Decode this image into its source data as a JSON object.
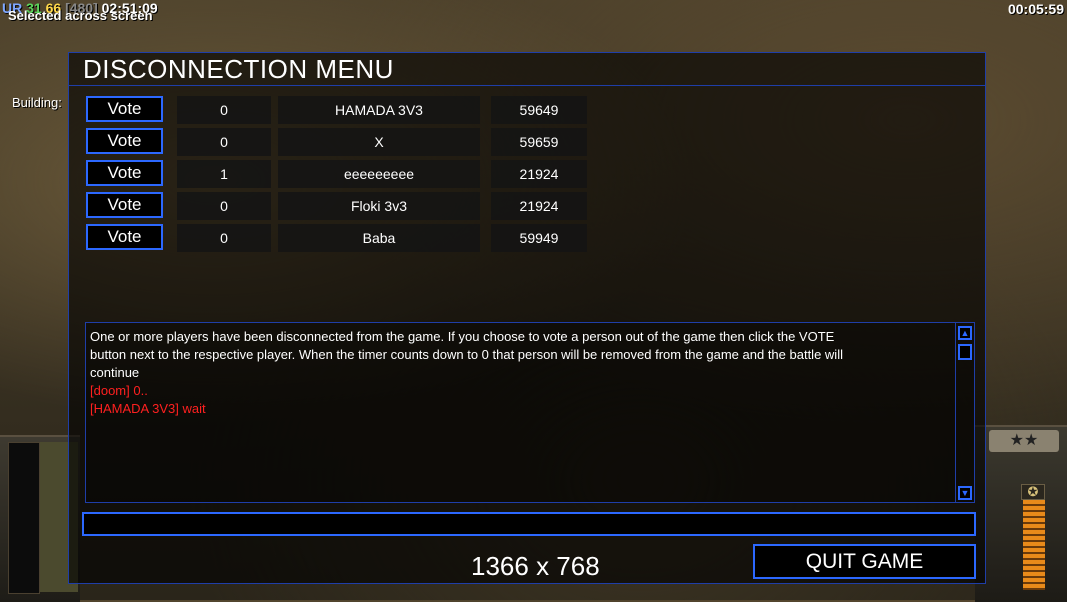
{
  "hud": {
    "ur_label": "UR",
    "stat_a": "31",
    "stat_b": "66",
    "stat_c": "[480]",
    "clock": "02:51:09",
    "selected_text": "Selected across screen",
    "game_timer": "00:05:59",
    "building_label": "Building:"
  },
  "menu": {
    "title": "DISCONNECTION MENU",
    "vote_label": "Vote",
    "players": [
      {
        "count": "0",
        "name": "HAMADA 3V3",
        "timer": "59649"
      },
      {
        "count": "0",
        "name": "X",
        "timer": "59659"
      },
      {
        "count": "1",
        "name": "eeeeeeeee",
        "timer": "21924"
      },
      {
        "count": "0",
        "name": "Floki 3v3",
        "timer": "21924"
      },
      {
        "count": "0",
        "name": "Baba",
        "timer": "59949"
      }
    ],
    "chat": {
      "info_line_1": "One or more players have been disconnected from the game. If you choose to vote a person out of the game then click the VOTE",
      "info_line_2": " button next to the respective player. When the timer counts down to 0 that person will be removed from the game and the battle will",
      "info_line_3": " continue",
      "messages": [
        "[doom] 0..",
        "[HAMADA 3V3] wait"
      ]
    },
    "chat_input_value": "",
    "resolution_text": "1366 x 768",
    "quit_label": "QUIT GAME"
  },
  "colors": {
    "accent_blue": "#2c68ff",
    "panel_border": "#1f3ea8",
    "chat_red": "#ff2020"
  }
}
